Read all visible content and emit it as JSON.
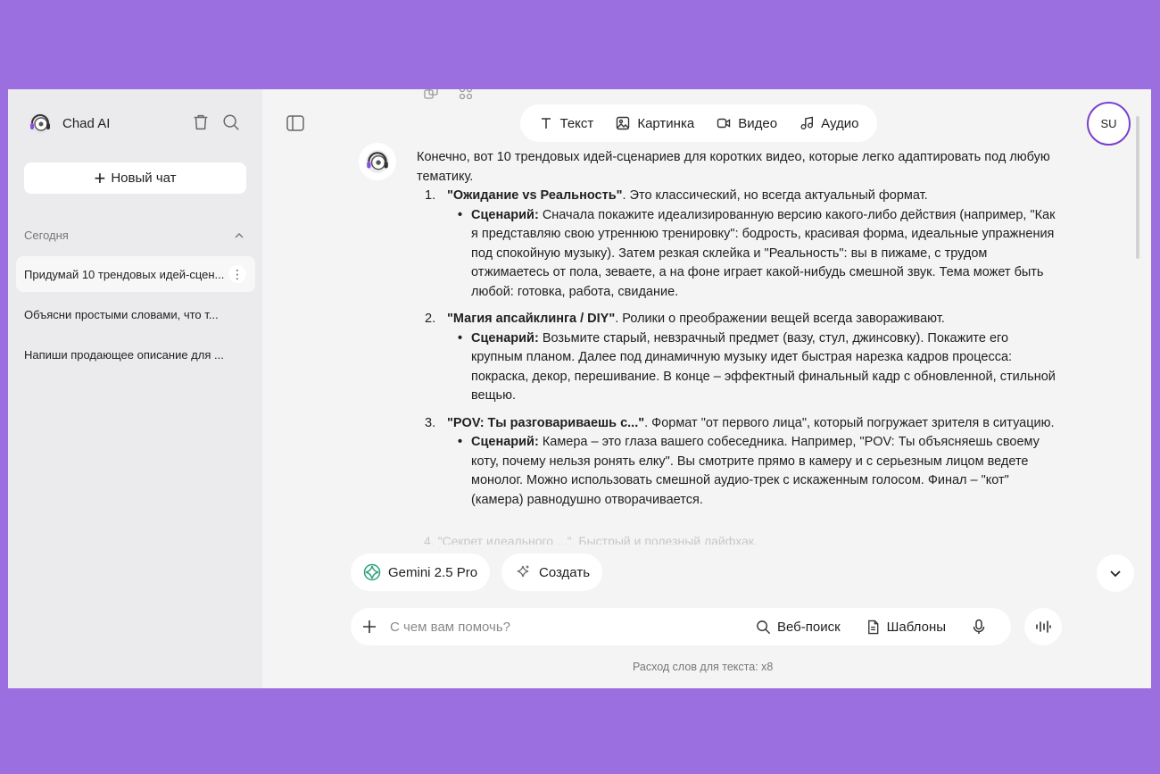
{
  "sidebar": {
    "app_name": "Chad AI",
    "new_chat_label": "Новый чат",
    "section_label": "Сегодня",
    "chats": [
      {
        "title": "Придумай 10 трендовых идей-сцен..."
      },
      {
        "title": "Объясни простыми словами, что т..."
      },
      {
        "title": "Напиши продающее описание для ..."
      }
    ]
  },
  "modes": {
    "text": "Текст",
    "image": "Картинка",
    "video": "Видео",
    "audio": "Аудио"
  },
  "user": {
    "initials": "SU"
  },
  "message": {
    "intro": "Конечно, вот 10 трендовых идей-сценариев для коротких видео, которые легко адаптировать под любую тематику.",
    "items": [
      {
        "num": "1.",
        "title": "\"Ожидание vs Реальность\"",
        "rest": ". Это классический, но всегда актуальный формат.",
        "sub_label": "Сценарий:",
        "sub_text": " Сначала покажите идеализированную версию какого-либо действия (например, \"Как я представляю свою утреннюю тренировку\": бодрость, красивая форма, идеальные упражнения под спокойную музыку). Затем резкая склейка и \"Реальность\": вы в пижаме, с трудом отжимаетесь от пола, зеваете, а на фоне играет какой-нибудь смешной звук. Тема может быть любой: готовка, работа, свидание."
      },
      {
        "num": "2.",
        "title": "\"Магия апсайклинга / DIY\"",
        "rest": ". Ролики о преображении вещей всегда завораживают.",
        "sub_label": "Сценарий:",
        "sub_text": " Возьмите старый, невзрачный предмет (вазу, стул, джинсовку). Покажите его крупным планом. Далее под динамичную музыку идет быстрая нарезка кадров процесса: покраска, декор, перешивание. В конце – эффектный финальный кадр с обновленной, стильной вещью."
      },
      {
        "num": "3.",
        "title": "\"POV: Ты разговариваешь с...\"",
        "rest": ". Формат \"от первого лица\", который погружает зрителя в ситуацию.",
        "sub_label": "Сценарий:",
        "sub_text": " Камера – это глаза вашего собеседника. Например, \"POV: Ты объясняешь своему коту, почему нельзя ронять елку\". Вы смотрите прямо в камеру и с серьезным лицом ведете монолог. Можно использовать смешной аудио-трек с искаженным голосом. Финал – \"кот\" (камера) равнодушно отворачивается."
      }
    ],
    "next_partial": "4.    \"Секрет идеального ...\". Быстрый и полезный лайфхак."
  },
  "bottom": {
    "model_label": "Gemini 2.5 Pro",
    "create_label": "Создать",
    "input_placeholder": "С чем вам помочь?",
    "web_search_label": "Веб-поиск",
    "templates_label": "Шаблоны",
    "usage_note": "Расход слов для текста: x8"
  },
  "colors": {
    "page_bg": "#9b6fe0",
    "avatar_border": "#7b3fd0",
    "gemini_green": "#2fa37a"
  }
}
